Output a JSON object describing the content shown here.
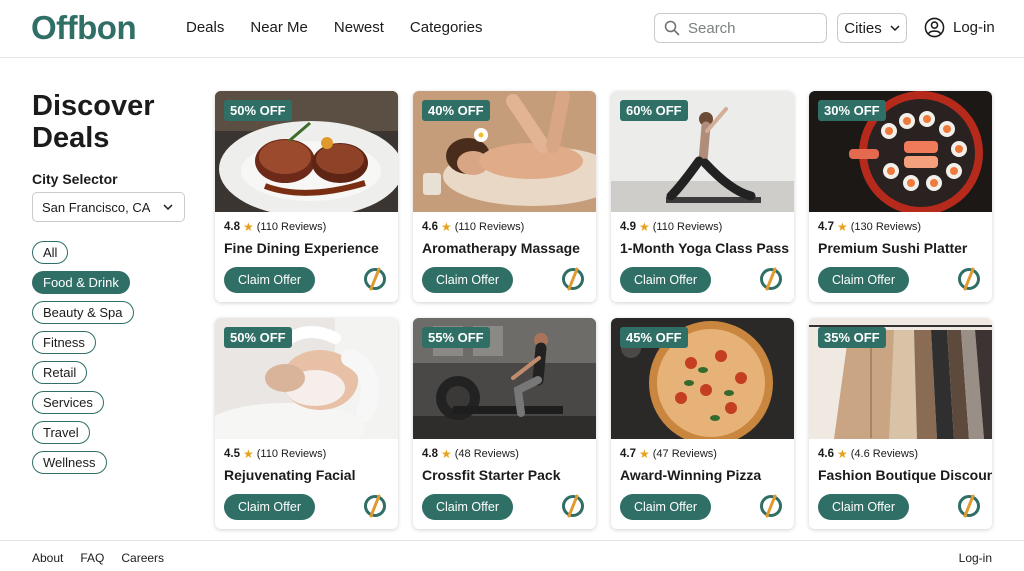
{
  "brand": {
    "name": "Offbon",
    "accent": "#2f6f66",
    "highlight": "#e29a2d"
  },
  "nav": [
    "Deals",
    "Near Me",
    "Newest",
    "Categories"
  ],
  "search": {
    "placeholder": "Search",
    "icon": "search-icon"
  },
  "cities_dropdown": {
    "label": "Cities",
    "icon": "chevron-down-icon"
  },
  "login": {
    "label": "Log-in",
    "icon": "user-circle-icon"
  },
  "sidebar": {
    "title": "Discover Deals",
    "city_label": "City Selector",
    "city_value": "San Francisco, CA",
    "categories": [
      {
        "label": "All",
        "active": false
      },
      {
        "label": "Food & Drink",
        "active": true
      },
      {
        "label": "Beauty & Spa",
        "active": false
      },
      {
        "label": "Fitness",
        "active": false
      },
      {
        "label": "Retail",
        "active": false
      },
      {
        "label": "Services",
        "active": false
      },
      {
        "label": "Travel",
        "active": false
      },
      {
        "label": "Wellness",
        "active": false
      }
    ]
  },
  "deals": [
    {
      "discount": "50% OFF",
      "rating": "4.8",
      "reviews": "(110 Reviews)",
      "title": "Fine Dining Experience",
      "cta": "Claim Offer",
      "image": "steak"
    },
    {
      "discount": "40% OFF",
      "rating": "4.6",
      "reviews": "(110 Reviews)",
      "title": "Aromatherapy Massage",
      "cta": "Claim Offer",
      "image": "massage"
    },
    {
      "discount": "60% OFF",
      "rating": "4.9",
      "reviews": "(110 Reviews)",
      "title": "1-Month Yoga Class Pass",
      "cta": "Claim Offer",
      "image": "yoga"
    },
    {
      "discount": "30% OFF",
      "rating": "4.7",
      "reviews": "(130 Reviews)",
      "title": "Premium Sushi Platter",
      "cta": "Claim Offer",
      "image": "sushi"
    },
    {
      "discount": "50% OFF",
      "rating": "4.5",
      "reviews": "(110 Reviews)",
      "title": "Rejuvenating Facial",
      "cta": "Claim Offer",
      "image": "facial"
    },
    {
      "discount": "55% OFF",
      "rating": "4.8",
      "reviews": "(48 Reviews)",
      "title": "Crossfit Starter Pack",
      "cta": "Claim Offer",
      "image": "crossfit"
    },
    {
      "discount": "45% OFF",
      "rating": "4.7",
      "reviews": "(47 Reviews)",
      "title": "Award-Winning Pizza",
      "cta": "Claim Offer",
      "image": "pizza"
    },
    {
      "discount": "35% OFF",
      "rating": "4.6",
      "reviews": "(4.6 Reviews)",
      "title": "Fashion Boutique Discount",
      "cta": "Claim Offer",
      "image": "fashion"
    }
  ],
  "footer": {
    "links": [
      "About",
      "FAQ",
      "Careers"
    ],
    "login": "Log-in"
  }
}
